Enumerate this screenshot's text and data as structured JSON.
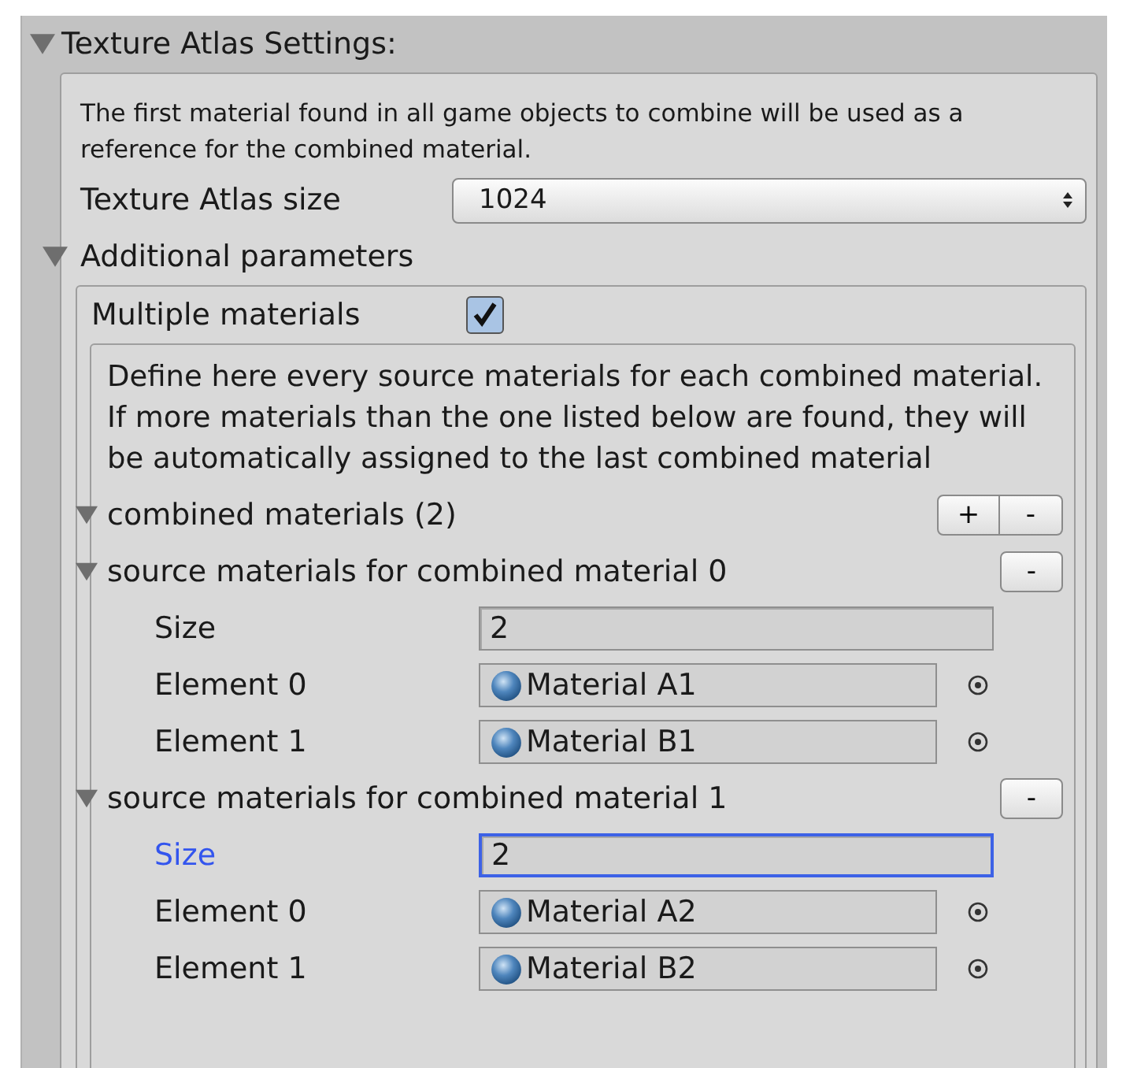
{
  "section": {
    "title": "Texture Atlas Settings:",
    "expanded": true
  },
  "description": "The first material found in all game objects to combine will be used as a reference for the combined material.",
  "atlas_size": {
    "label": "Texture Atlas size",
    "value": "1024"
  },
  "additional": {
    "title": "Additional parameters",
    "expanded": true
  },
  "multiple_materials": {
    "label": "Multiple materials",
    "checked": true
  },
  "help": "Define here every source materials for each combined material. If more materials than the one listed below are found, they will be automatically assigned to the last combined material",
  "combined": {
    "title": "combined materials (2)",
    "expanded": true,
    "buttons": [
      "+",
      "-"
    ]
  },
  "groups": [
    {
      "title": "source materials for combined material 0",
      "expanded": true,
      "remove_button": "-",
      "size": {
        "label": "Size",
        "value": "2",
        "focused": false
      },
      "elements": [
        {
          "label": "Element 0",
          "value": "Material A1"
        },
        {
          "label": "Element 1",
          "value": "Material B1"
        }
      ]
    },
    {
      "title": "source materials for combined material 1",
      "expanded": true,
      "remove_button": "-",
      "size": {
        "label": "Size",
        "value": "2",
        "focused": true
      },
      "elements": [
        {
          "label": "Element 0",
          "value": "Material A2"
        },
        {
          "label": "Element 1",
          "value": "Material B2"
        }
      ]
    }
  ]
}
